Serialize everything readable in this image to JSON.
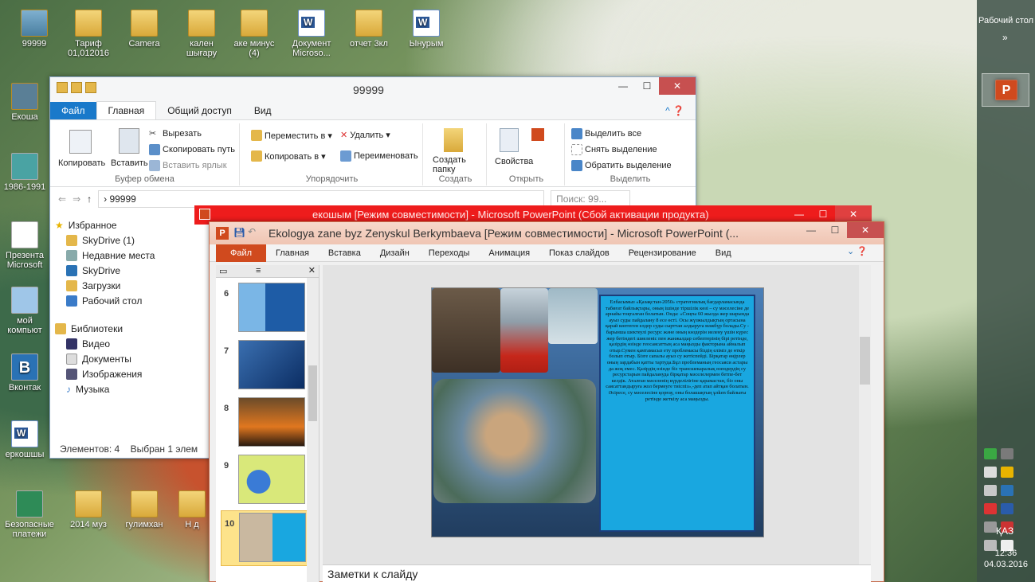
{
  "desktop": {
    "icons_top": [
      "99999",
      "Тариф 01,012016",
      "Camera",
      "кален шығару",
      "аке минус (4)",
      "Документ Microso...",
      "отчет 3кл",
      "Ынурым"
    ],
    "icons_left": [
      "Екоша",
      "1986-1991",
      "Презента Microsoft",
      "мой компьют",
      "Вконтак",
      "еркошшы"
    ],
    "icons_bottom": [
      "Безопасные платежи",
      "2014 муз",
      "гулимхан",
      "Н д"
    ]
  },
  "taskbar": {
    "label": "Рабочий стол",
    "chevron": "»",
    "lang": "ҚАЗ",
    "time": "12:36",
    "date": "04.03.2016"
  },
  "explorer": {
    "title": "99999",
    "tabs": [
      "Файл",
      "Главная",
      "Общий доступ",
      "Вид"
    ],
    "clipboard": {
      "copy": "Копировать",
      "paste": "Вставить",
      "cut": "Вырезать",
      "copy_path": "Скопировать путь",
      "paste_shortcut": "Вставить ярлык",
      "group": "Буфер обмена"
    },
    "organize": {
      "move_to": "Переместить в ▾",
      "copy_to": "Копировать в ▾",
      "delete": "Удалить ▾",
      "rename": "Переименовать",
      "group": "Упорядочить"
    },
    "create": {
      "new_folder": "Создать папку",
      "group": "Создать"
    },
    "open": {
      "properties": "Свойства",
      "group": "Открыть"
    },
    "select": {
      "all": "Выделить все",
      "none": "Снять выделение",
      "invert": "Обратить выделение",
      "group": "Выделить"
    },
    "address": "› 99999",
    "search_placeholder": "Поиск: 99...",
    "nav": [
      "Избранное",
      "SkyDrive (1)",
      "Недавние места",
      "SkyDrive",
      "Загрузки",
      "Рабочий стол",
      "Библиотеки",
      "Видео",
      "Документы",
      "Изображения",
      "Музыка"
    ],
    "status_items": "Элементов: 4",
    "status_selected": "Выбран 1 элем"
  },
  "ppt_back": {
    "title": "екошым [Режим совместимости] - Microsoft PowerPoint (Сбой активации продукта)"
  },
  "powerpoint": {
    "title": "Ekologya zane byz Zenyskul Berkymbaeva [Режим совместимости] - Microsoft PowerPoint (...",
    "tabs": [
      "Файл",
      "Главная",
      "Вставка",
      "Дизайн",
      "Переходы",
      "Анимация",
      "Показ слайдов",
      "Рецензирование",
      "Вид"
    ],
    "thumbs": [
      "6",
      "7",
      "8",
      "9",
      "10"
    ],
    "slide_text": "Елбасымыз «Қазақстан-2050» стратегиялық бағдарламасында табиғат байлықтары, оның ішінде тіршілік көзі – су мәселесіне де арнайы тоқталған болатын. Онда: «Соңғы 60 жылда жер шарында ауыз суды пайдалану 8 есе өсті. Осы жүзжылдықтың ортасына қарай көптеген елдер суды сырттан алдыруға мәжбүр болады.Су - барынша шектеулі ресурс және оның көздерін иелену үшін күрес жер бетіндегі шиеленіс пен жанжалдар себептерінің бірі ретінде, қазірдің өзінде геосаясаттың аса маңызды факторына айналып отыр.Сумен қамтамасыз ету проблемасы біздің еліміз де өткір болып отыр. Бізге сапалы ауыз су жетіспейді. Бірқатар өңірлер оның зардабын қатты тартуда.Бұл проблеманың геосаяси астары да жоқ емес. Қазірдің өзінде біз трансшекаралық өзендердің су ресурстарын пайдалануда бірқатар мәселелермен бетпе-бет келдік. Аталған мәселенің күрделілігіне қарамастан, біз оны саясаттандыруға жол бермеуге тиіспіз»,-деп атап айтқан болатын. Әсіресе, су мәселесіне қорғау, оны болашақтың ұлken байлығы ретінде жеткізу аса маңызды.",
    "notes_placeholder": "Заметки к слайду"
  }
}
